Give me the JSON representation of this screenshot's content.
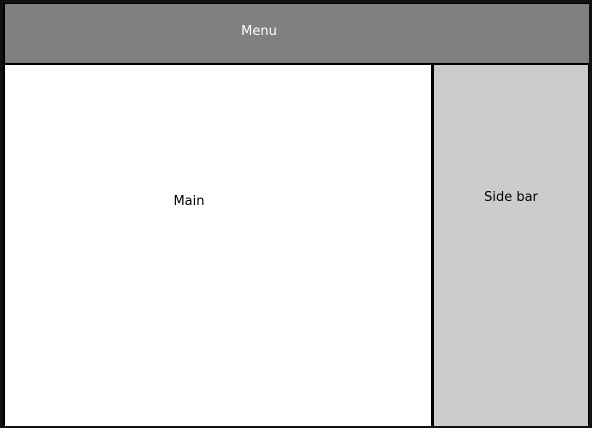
{
  "menu": {
    "label": "Menu"
  },
  "main": {
    "label": "Main"
  },
  "sidebar": {
    "label": "Side bar"
  },
  "colors": {
    "menu_bg": "#808080",
    "main_bg": "#ffffff",
    "sidebar_bg": "#cccccc",
    "border": "#111111"
  }
}
